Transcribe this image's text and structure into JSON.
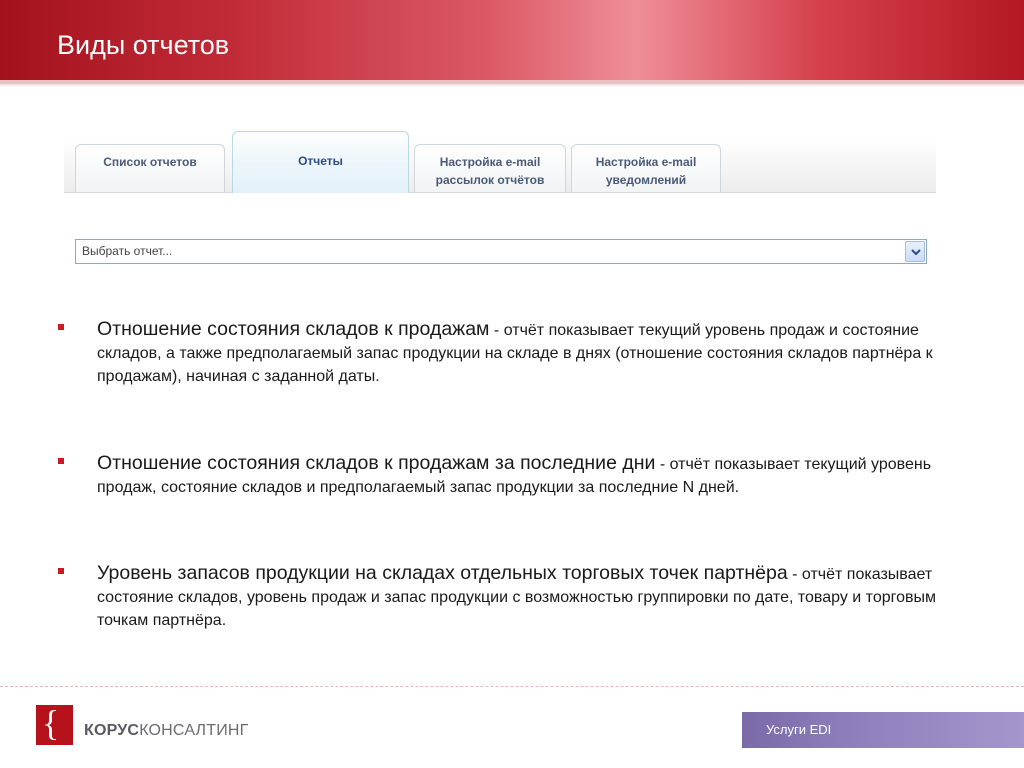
{
  "slide": {
    "title": "Виды отчетов"
  },
  "ui": {
    "tabs": [
      {
        "line1": "Список отчетов",
        "line2": ""
      },
      {
        "line1": "Отчеты",
        "line2": ""
      },
      {
        "line1": "Настройка e-mail",
        "line2": "рассылок отчётов"
      },
      {
        "line1": "Настройка e-mail",
        "line2": "уведомлений"
      }
    ],
    "active_tab": "Отчеты",
    "select": {
      "value": "Выбрать отчет...",
      "icon": "chevron-down-icon"
    }
  },
  "bullets": [
    {
      "head": "Отношение состояния складов к продажам",
      "body": " - отчёт показывает текущий уровень продаж и состояние складов, а также предполагаемый запас продукции на складе в днях (отношение состояния складов партнёра к продажам), начиная с заданной даты."
    },
    {
      "head": "Отношение состояния складов к продажам за последние дни",
      "body": " - отчёт показывает текущий уровень продаж, состояние складов и предполагаемый запас продукции за последние N дней."
    },
    {
      "head": "Уровень запасов продукции на складах отдельных торговых точек партнёра",
      "body": " - отчёт показывает состояние складов, уровень продаж и запас продукции с возможностью группировки по дате, товару и торговым точкам партнёра."
    }
  ],
  "footer": {
    "logo_bold": "КОРУС",
    "logo_rest": "КОНСАЛТИНГ",
    "logo_glyph": "{",
    "badge": "Услуги EDI"
  },
  "colors": {
    "accent_red": "#b5121b",
    "bullet_marker": "#cc1a24",
    "badge_purple": "#8f7fbc"
  }
}
